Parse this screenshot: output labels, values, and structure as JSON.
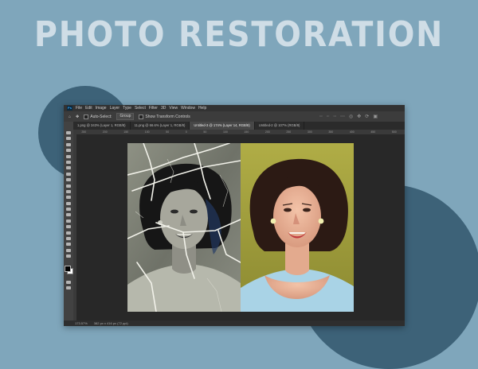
{
  "headline": "PHOTO RESTORATION",
  "colors": {
    "background": "#7fa6bb",
    "headline": "#cfdde6",
    "circles": "#3d6278",
    "ps_ui": "#535353",
    "canvas": "#282828",
    "after_backdrop": "#a4a13c",
    "after_shirt": "#a9d3e6"
  },
  "app": {
    "logo": "Ps",
    "menu": [
      "File",
      "Edit",
      "Image",
      "Layer",
      "Type",
      "Select",
      "Filter",
      "3D",
      "View",
      "Window",
      "Help"
    ],
    "options": {
      "home_icon": "home-icon",
      "move_icon": "move-tool-icon",
      "auto_select": "Auto-Select:",
      "layer_select": "Group",
      "transform": "Show Transform Controls"
    },
    "tabs": [
      "1.png @ 343% (Layer 1, RGB/8)",
      "11.png @ 66.6% (Layer 1, RGB/8)",
      "Untitled-3 @ 174% (Layer 14, RGB/8)",
      "Untitled-2 @ 107% (RGB/8)"
    ],
    "status": [
      "173.57%",
      "382 px x 416 px (72 ppi)"
    ],
    "ruler_ticks": [
      "250",
      "200",
      "150",
      "100",
      "50",
      "0",
      "50",
      "100",
      "150",
      "200",
      "250",
      "300",
      "350",
      "400",
      "450",
      "500"
    ]
  },
  "images": {
    "before": "damaged black-and-white portrait with cracks",
    "after": "restored colorized portrait"
  }
}
